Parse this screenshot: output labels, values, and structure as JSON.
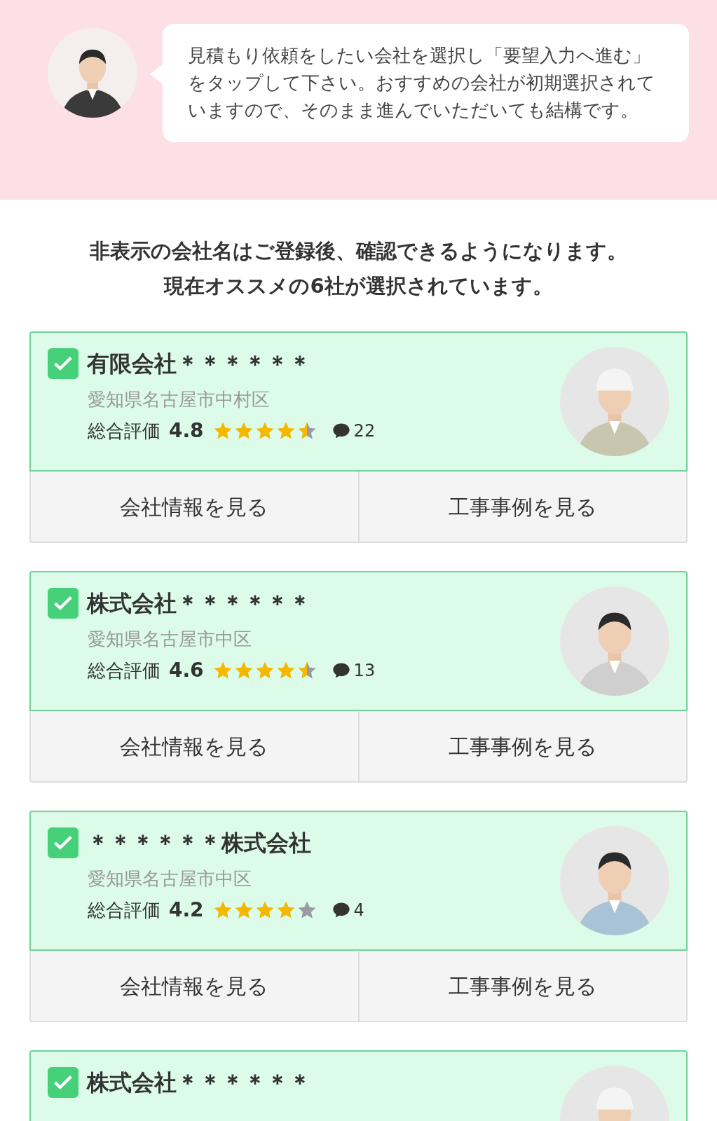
{
  "intro": {
    "message": "見積もり依頼をしたい会社を選択し「要望入力へ進む」をタップして下さい。おすすめの会社が初期選択されていますので、そのまま進んでいただいても結構です。"
  },
  "notice": [
    "非表示の会社名はご登録後、確認できるようになります。",
    "現在オススメの6社が選択されています。"
  ],
  "companies": [
    {
      "name": "有限会社＊＊＊＊＊＊",
      "checked": true,
      "address": "愛知県名古屋市中村区",
      "rating_label": "総合評価",
      "score": "4.8",
      "stars": 4.5,
      "reviews": "22",
      "buttons": [
        "会社情報を見る",
        "工事事例を見る"
      ]
    },
    {
      "name": "株式会社＊＊＊＊＊＊",
      "checked": true,
      "address": "愛知県名古屋市中区",
      "rating_label": "総合評価",
      "score": "4.6",
      "stars": 4.5,
      "reviews": "13",
      "buttons": [
        "会社情報を見る",
        "工事事例を見る"
      ]
    },
    {
      "name": "＊＊＊＊＊＊株式会社",
      "checked": true,
      "address": "愛知県名古屋市中区",
      "rating_label": "総合評価",
      "score": "4.2",
      "stars": 4,
      "reviews": "4",
      "buttons": [
        "会社情報を見る",
        "工事事例を見る"
      ]
    },
    {
      "name": "株式会社＊＊＊＊＊＊",
      "checked": true
    }
  ]
}
